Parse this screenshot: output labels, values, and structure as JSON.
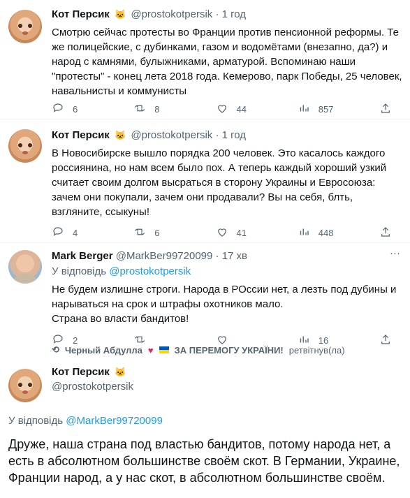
{
  "tweets": [
    {
      "name": "Кот Персик",
      "handle": "@prostokotpersik",
      "time": "· 1 год",
      "text": "Смотрю сейчас протесты во Франции против пенсионной реформы. Те же полицейские, с дубинками, газом и водомётами (внезапно, да?) и народ с камнями, булыжниками, арматурой. Вспоминаю наши \"протесты\" - конец лета 2018 года. Кемерово, парк Победы, 25 человек, навальнисты и коммунисты",
      "reply_count": "6",
      "retweet_count": "8",
      "like_count": "44",
      "views": "857"
    },
    {
      "name": "Кот Персик",
      "handle": "@prostokotpersik",
      "time": "· 1 год",
      "text": "В Новосибирске вышло порядка 200 человек. Это касалось каждого россиянина, но нам всем было пох. А теперь каждый хороший узкий считает своим долгом высраться в сторону Украины и Евросоюза: зачем они покупали, зачем они продавали? Вы на себя, блть, взгляните, ссыкуны!",
      "reply_count": "4",
      "retweet_count": "6",
      "like_count": "41",
      "views": "448"
    },
    {
      "name": "Mark Berger",
      "handle": "@MarkBer99720099",
      "time": "· 17 хв",
      "reply_prefix": "У відповідь",
      "reply_handle": "@prostokotpersik",
      "text": "Не будем излишне строги. Народа в РОссии нет, а лезть под дубины и нарываться на срок и штрафы охотников мало.\n Страна во власти бандитов!",
      "reply_count": "2",
      "retweet_count": "",
      "like_count": "",
      "views": "16"
    }
  ],
  "retweeted_line": {
    "user": "Черный Абдулла",
    "tag": "ЗА ПЕРЕМОГУ УКРАЇНИ!",
    "suffix": "ретвітнув(ла)"
  },
  "main_tweet": {
    "name": "Кот Персик",
    "handle": "@prostokotpersik",
    "reply_prefix": "У відповідь",
    "reply_handle": "@MarkBer99720099",
    "text": "Друже, наша страна под властью бандитов, потому народа нет, а есть в абсолютном большинстве своём скот. В Германии, Украине, Франции народ, а у нас скот, в абсолютном большинстве своём."
  },
  "icons": {
    "reply": "reply-icon",
    "retweet": "retweet-icon",
    "like": "heart-icon",
    "views": "views-icon",
    "share": "share-icon",
    "more": "more-icon"
  }
}
